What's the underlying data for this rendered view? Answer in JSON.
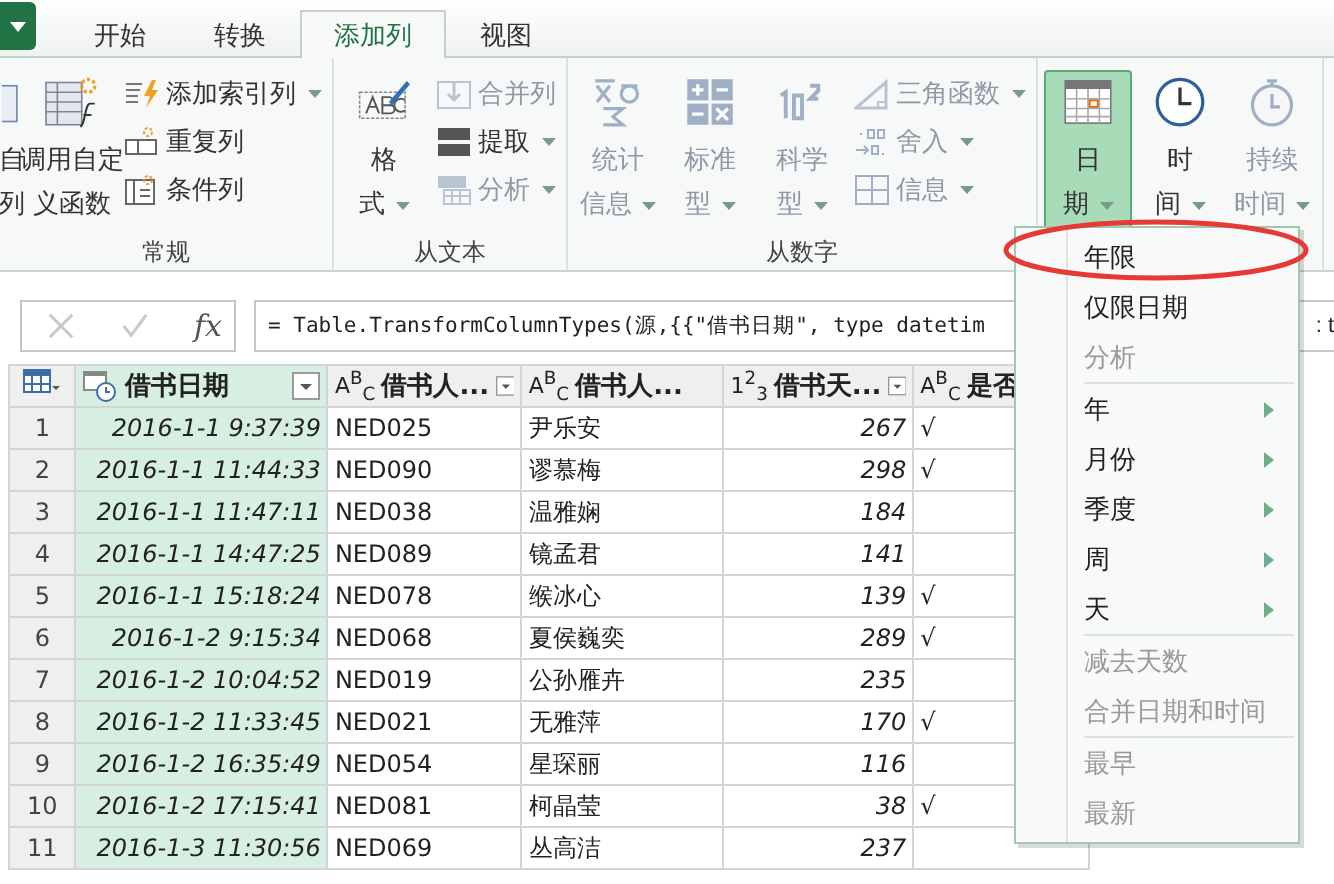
{
  "tabs": [
    {
      "label": "开始",
      "selected": false
    },
    {
      "label": "转换",
      "selected": false
    },
    {
      "label": "添加列",
      "selected": true
    },
    {
      "label": "视图",
      "selected": false
    }
  ],
  "ribbon": {
    "groups": [
      {
        "label": "常规",
        "large": [
          {
            "kind": "example",
            "lines": [
              "自",
              "列"
            ],
            "dropdown": false,
            "disabled": false,
            "selected": false
          },
          {
            "kind": "function",
            "lines": [
              "调用自定",
              "义函数"
            ],
            "dropdown": false,
            "disabled": false,
            "selected": false
          }
        ],
        "small": [
          {
            "kind": "index",
            "label": "添加索引列",
            "dropdown": true,
            "disabled": false
          },
          {
            "kind": "duplicate",
            "label": "重复列",
            "dropdown": false,
            "disabled": false
          },
          {
            "kind": "conditional",
            "label": "条件列",
            "dropdown": false,
            "disabled": false
          }
        ]
      },
      {
        "label": "从文本",
        "large": [
          {
            "kind": "format",
            "lines": [
              "格",
              "式"
            ],
            "dropdown": true,
            "disabled": false,
            "selected": false
          }
        ],
        "small": [
          {
            "kind": "merge",
            "label": "合并列",
            "dropdown": false,
            "disabled": true
          },
          {
            "kind": "extract",
            "label": "提取",
            "dropdown": true,
            "disabled": false
          },
          {
            "kind": "parse",
            "label": "分析",
            "dropdown": true,
            "disabled": true
          }
        ]
      },
      {
        "label": "从数字",
        "large": [
          {
            "kind": "stats",
            "lines": [
              "统计",
              "信息"
            ],
            "dropdown": true,
            "disabled": true,
            "selected": false
          },
          {
            "kind": "standard",
            "lines": [
              "标准",
              "型"
            ],
            "dropdown": true,
            "disabled": true,
            "selected": false
          },
          {
            "kind": "science",
            "lines": [
              "科学",
              "型"
            ],
            "dropdown": true,
            "disabled": true,
            "selected": false
          }
        ],
        "small": [
          {
            "kind": "trig",
            "label": "三角函数",
            "dropdown": true,
            "disabled": true
          },
          {
            "kind": "round",
            "label": "舍入",
            "dropdown": true,
            "disabled": true
          },
          {
            "kind": "info",
            "label": "信息",
            "dropdown": true,
            "disabled": true
          }
        ]
      },
      {
        "large": [
          {
            "kind": "date",
            "lines": [
              "日",
              "期"
            ],
            "dropdown": true,
            "disabled": false,
            "selected": true
          },
          {
            "kind": "time",
            "lines": [
              "时",
              "间"
            ],
            "dropdown": true,
            "disabled": false,
            "selected": false
          },
          {
            "kind": "duration",
            "lines": [
              "持续",
              "时间"
            ],
            "dropdown": true,
            "disabled": true,
            "selected": false
          }
        ]
      }
    ]
  },
  "formula_bar": {
    "fx": "fx",
    "formula": "= Table.TransformColumnTypes(源,{{\"借书日期\", type datetim",
    "formula_tail": ": t"
  },
  "table": {
    "columns": [
      {
        "label": "借书日期",
        "filter": true,
        "selected": true
      },
      {
        "label": "借书人...",
        "type_label": "A$^{B}$$_{C}$",
        "filter": true,
        "selected": false
      },
      {
        "label": "借书人...",
        "type_label": "A$^{B}$$_{C}$",
        "filter": false,
        "selected": false
      },
      {
        "label": "借书天...",
        "type_label": "1$^{2}$$_{3}$",
        "filter": true,
        "selected": false
      },
      {
        "label": "是否",
        "type_label": "A$^{B}$$_{C}$",
        "selected": false
      }
    ],
    "rows": [
      {
        "num": "1",
        "cells": [
          "2016-1-1 9:37:39",
          "NED025",
          "尹乐安",
          "267",
          "√"
        ]
      },
      {
        "num": "2",
        "cells": [
          "2016-1-1 11:44:33",
          "NED090",
          "谬慕梅",
          "298",
          "√"
        ]
      },
      {
        "num": "3",
        "cells": [
          "2016-1-1 11:47:11",
          "NED038",
          "温雅娴",
          "184",
          ""
        ]
      },
      {
        "num": "4",
        "cells": [
          "2016-1-1 14:47:25",
          "NED089",
          "镜孟君",
          "141",
          ""
        ]
      },
      {
        "num": "5",
        "cells": [
          "2016-1-1 15:18:24",
          "NED078",
          "缑冰心",
          "139",
          "√"
        ]
      },
      {
        "num": "6",
        "cells": [
          "2016-1-2 9:15:34",
          "NED068",
          "夏侯巍奕",
          "289",
          "√"
        ]
      },
      {
        "num": "7",
        "cells": [
          "2016-1-2 10:04:52",
          "NED019",
          "公孙雁卉",
          "235",
          ""
        ]
      },
      {
        "num": "8",
        "cells": [
          "2016-1-2 11:33:45",
          "NED021",
          "无雅萍",
          "170",
          "√"
        ]
      },
      {
        "num": "9",
        "cells": [
          "2016-1-2 16:35:49",
          "NED054",
          "星琛丽",
          "116",
          ""
        ]
      },
      {
        "num": "10",
        "cells": [
          "2016-1-2 17:15:41",
          "NED081",
          "柯晶莹",
          "38",
          "√"
        ]
      },
      {
        "num": "11",
        "cells": [
          "2016-1-3 11:30:56",
          "NED069",
          "丛高洁",
          "237",
          ""
        ]
      }
    ]
  },
  "date_menu": {
    "items": [
      {
        "kind": "item",
        "label": "年限",
        "disabled": false,
        "submenu": false
      },
      {
        "kind": "item",
        "label": "仅限日期",
        "disabled": false,
        "submenu": false
      },
      {
        "kind": "item",
        "label": "分析",
        "disabled": true,
        "submenu": false
      },
      {
        "kind": "separator"
      },
      {
        "kind": "item",
        "label": "年",
        "disabled": false,
        "submenu": true
      },
      {
        "kind": "item",
        "label": "月份",
        "disabled": false,
        "submenu": true
      },
      {
        "kind": "item",
        "label": "季度",
        "disabled": false,
        "submenu": true
      },
      {
        "kind": "item",
        "label": "周",
        "disabled": false,
        "submenu": true
      },
      {
        "kind": "item",
        "label": "天",
        "disabled": false,
        "submenu": true
      },
      {
        "kind": "separator"
      },
      {
        "kind": "item",
        "label": "减去天数",
        "disabled": true,
        "submenu": false
      },
      {
        "kind": "item",
        "label": "合并日期和时间",
        "disabled": true,
        "submenu": false
      },
      {
        "kind": "separator"
      },
      {
        "kind": "item",
        "label": "最早",
        "disabled": true,
        "submenu": false
      },
      {
        "kind": "item",
        "label": "最新",
        "disabled": true,
        "submenu": false
      }
    ]
  }
}
